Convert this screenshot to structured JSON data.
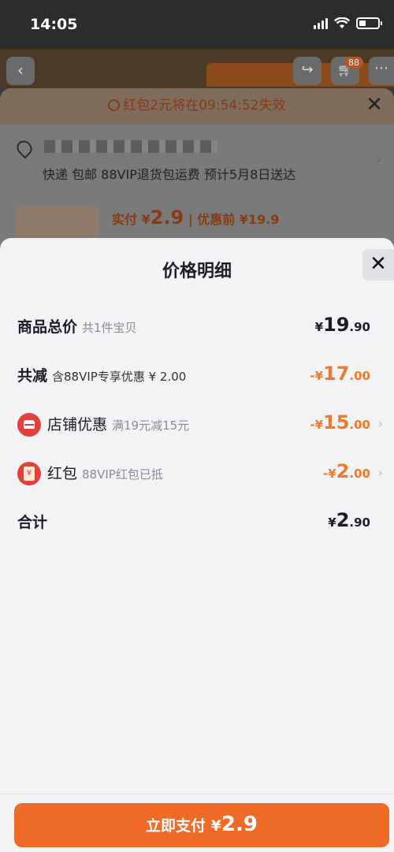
{
  "status": {
    "time": "14:05"
  },
  "topbar": {
    "cart_badge": "88"
  },
  "order": {
    "countdown_text": "红包2元将在09:54:52失效",
    "delivery_text": "快递 包邮 88VIP退货包运费 预计5月8日送达",
    "price_prefix": "实付 ¥",
    "price_value": "2.9",
    "price_before": "| 优惠前 ¥19.9"
  },
  "modal": {
    "title": "价格明细",
    "rows": [
      {
        "label": "商品总价",
        "sub": "共1件宝贝",
        "amount_sym": "¥",
        "amount_int": "19",
        "amount_dec": ".90"
      },
      {
        "label": "共减",
        "sub": "含88VIP专享优惠 ¥ 2.00",
        "amount_sym": "-¥",
        "amount_int": "17",
        "amount_dec": ".00"
      },
      {
        "label": "店铺优惠",
        "sub": "满19元减15元",
        "amount_sym": "-¥",
        "amount_int": "15",
        "amount_dec": ".00"
      },
      {
        "label": "红包",
        "sub": "88VIP红包已抵",
        "amount_sym": "-¥",
        "amount_int": "2",
        "amount_dec": ".00"
      },
      {
        "label": "合计",
        "sub": "",
        "amount_sym": "¥",
        "amount_int": "2",
        "amount_dec": ".90"
      }
    ]
  },
  "pay": {
    "label": "立即支付 ¥",
    "amount": "2.9"
  },
  "colors": {
    "accent": "#ee6a26",
    "discount": "#f07a2a",
    "icon_red": "#e2403c"
  },
  "icons": [
    "back-icon",
    "share-icon",
    "cart-icon",
    "more-icon",
    "clock-icon",
    "close-icon",
    "location-pin-icon",
    "shop-icon",
    "red-envelope-icon",
    "chevron-right-icon"
  ]
}
